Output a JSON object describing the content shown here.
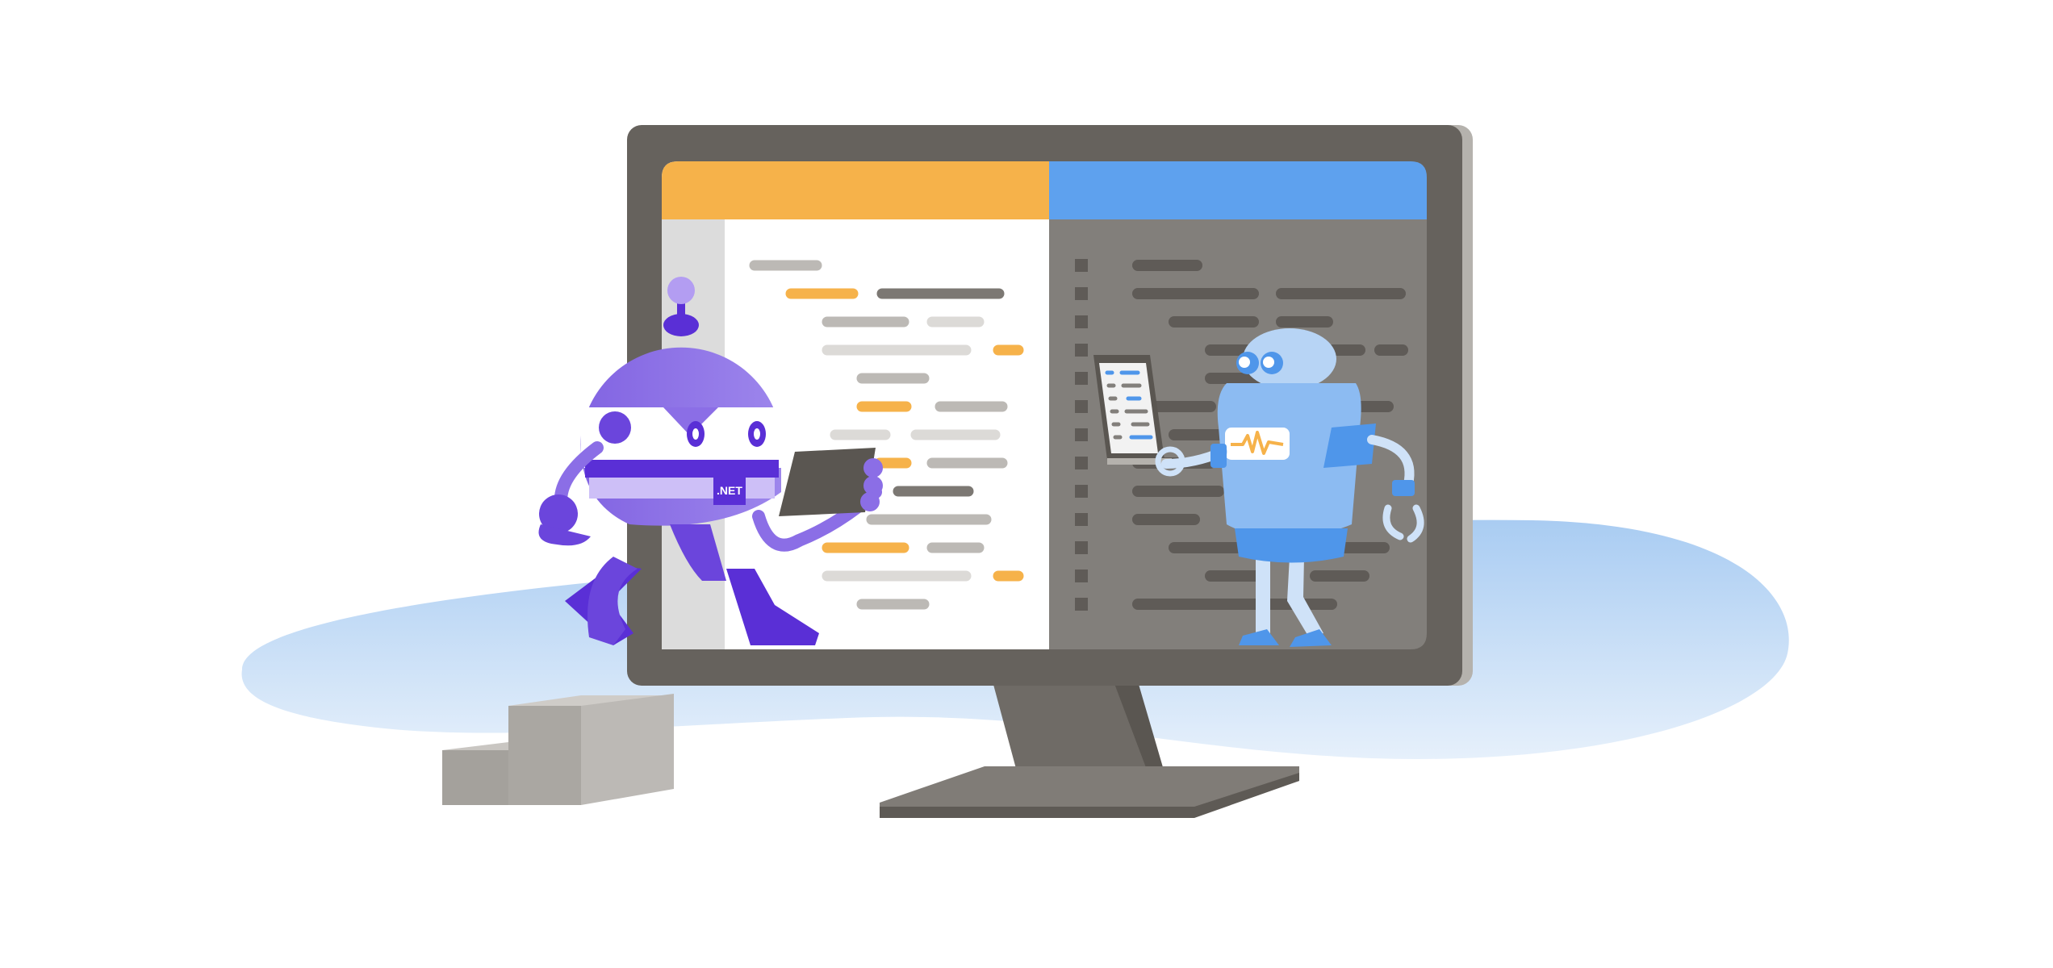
{
  "illustration": {
    "badge_text": ".NET",
    "colors": {
      "background": "#ffffff",
      "floor_blob": "#c5dcf5",
      "monitor_frame": "#66625d",
      "monitor_edge": "#b5b2ad",
      "left_pane_header": "#f6b24a",
      "right_pane_header": "#5ea1ee",
      "left_pane_bg": "#ffffff",
      "left_gutter": "#dcdcdc",
      "right_pane_bg": "#827f7b",
      "code_light": "#bcb9b5",
      "code_dark": "#7c7873",
      "code_accent": "#f6b24a",
      "right_code": "#5f5b57",
      "dotnet_bot_primary": "#8b6ee6",
      "dotnet_bot_dark": "#5a2fd6",
      "blue_bot_primary": "#8cbbf2",
      "blue_bot_dark": "#4f96ea",
      "steps_light": "#b7b4af",
      "steps_dark": "#a4a19c"
    },
    "icons": [
      "monitor-icon",
      "dotnet-bot-icon",
      "blue-bot-icon",
      "tablet-icon",
      "steps-icon"
    ]
  }
}
